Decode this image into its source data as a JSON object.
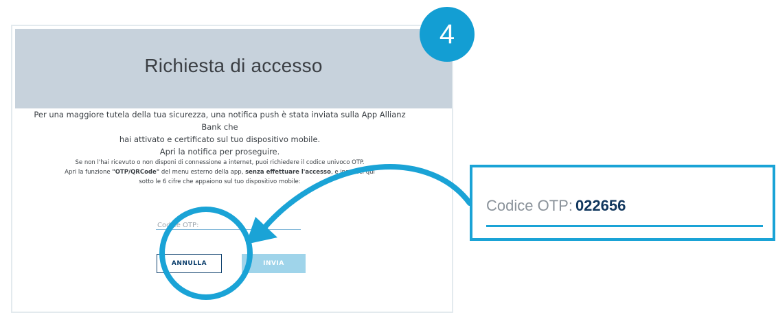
{
  "step": {
    "number": "4"
  },
  "dialog": {
    "title": "Richiesta di accesso",
    "main_message": [
      "Per una maggiore tutela della tua sicurezza, una notifica push è stata inviata sulla App Allianz Bank che",
      "hai attivato e certificato sul tuo dispositivo mobile.",
      "Apri la notifica per proseguire."
    ],
    "otp_message": {
      "line1": "Se non l'hai ricevuto o non disponi di connessione a internet, puoi richiedere il codice univoco OTP.",
      "line2_pre": "Apri la funzione ",
      "line2_bold1": "\"OTP/QRCode\"",
      "line2_mid": " del menu esterno della app, ",
      "line2_bold2": "senza effettuare l'accesso",
      "line2_post": ", e inserisci qui",
      "line3": "sotto le 6 cifre che appaiono sul tuo dispositivo mobile:"
    },
    "otp_input": {
      "placeholder": "Codice OTP:",
      "value": ""
    },
    "buttons": {
      "cancel": "ANNULLA",
      "send": "INVIA"
    }
  },
  "callout": {
    "label": "Codice OTP:",
    "value": "022656"
  },
  "colors": {
    "accent": "#1aa3d6",
    "header_bg": "#c7d2dc",
    "navy": "#0a3d6b",
    "send_button": "#9fd4ea"
  }
}
